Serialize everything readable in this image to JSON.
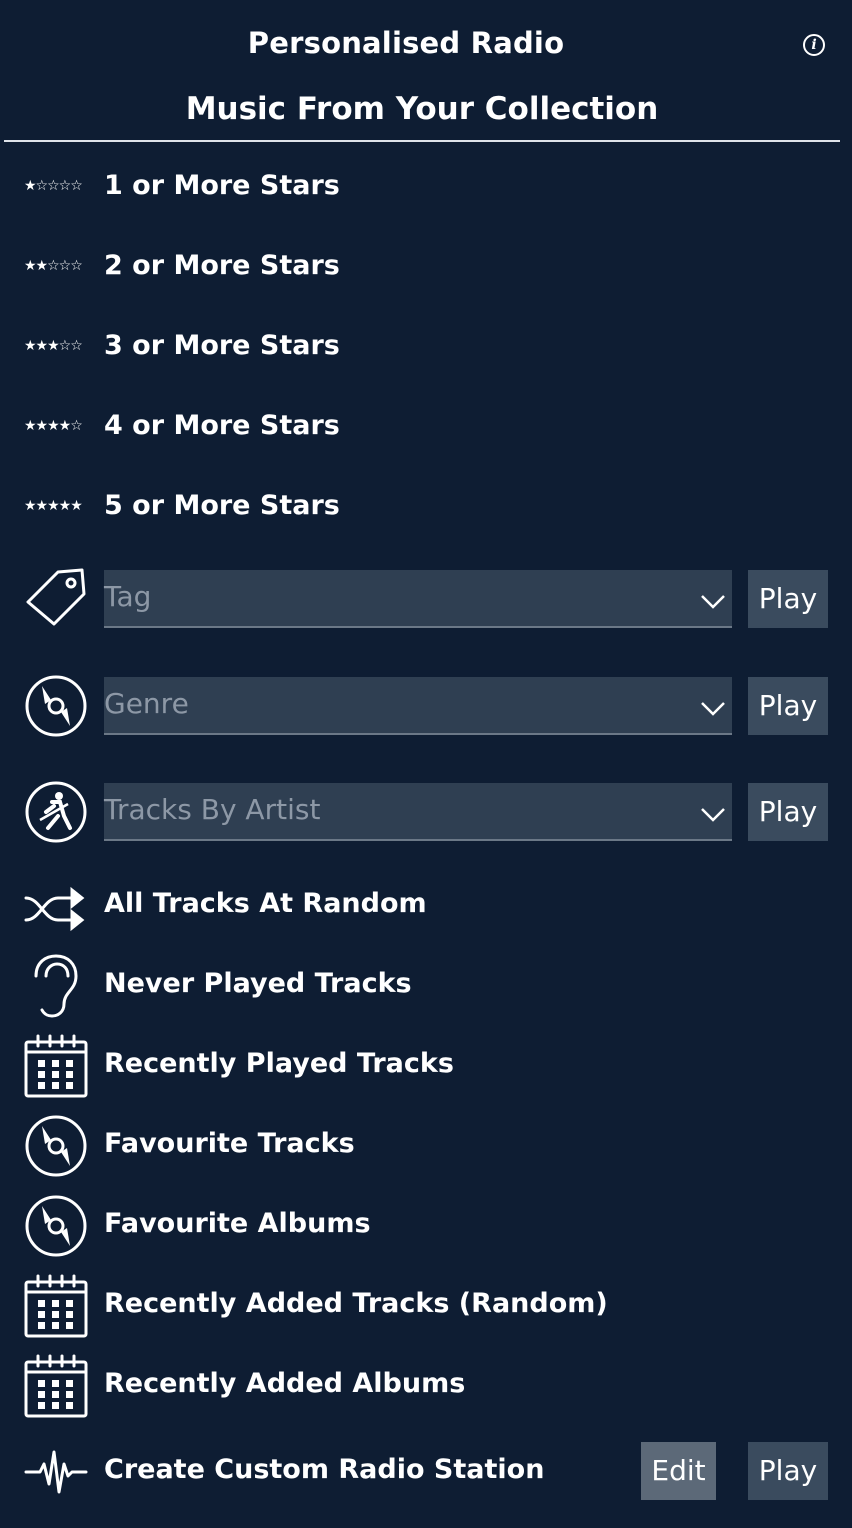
{
  "header": {
    "title": "Personalised Radio",
    "subtitle": "Music From Your Collection"
  },
  "star_items": [
    {
      "stars": "★☆☆☆☆",
      "label": "1 or More Stars"
    },
    {
      "stars": "★★☆☆☆",
      "label": "2 or More Stars"
    },
    {
      "stars": "★★★☆☆",
      "label": "3 or More Stars"
    },
    {
      "stars": "★★★★☆",
      "label": "4 or More Stars"
    },
    {
      "stars": "★★★★★",
      "label": "5 or More Stars"
    }
  ],
  "selectors": [
    {
      "icon": "tag-icon",
      "placeholder": "Tag",
      "play_label": "Play"
    },
    {
      "icon": "disc-icon",
      "placeholder": "Genre",
      "play_label": "Play"
    },
    {
      "icon": "guitarist-icon",
      "placeholder": "Tracks By Artist",
      "play_label": "Play"
    }
  ],
  "list_items": [
    {
      "icon": "shuffle-icon",
      "label": "All Tracks At Random"
    },
    {
      "icon": "ear-icon",
      "label": "Never Played Tracks"
    },
    {
      "icon": "calendar-icon",
      "label": "Recently Played Tracks"
    },
    {
      "icon": "disc-icon",
      "label": "Favourite Tracks"
    },
    {
      "icon": "disc-icon",
      "label": "Favourite Albums"
    },
    {
      "icon": "calendar-icon",
      "label": "Recently Added Tracks (Random)"
    },
    {
      "icon": "calendar-icon",
      "label": "Recently Added Albums"
    }
  ],
  "custom_station": {
    "icon": "waveform-icon",
    "label": "Create Custom Radio Station",
    "edit_label": "Edit",
    "play_label": "Play"
  },
  "colors": {
    "background": "#0e1d33",
    "select_bg": "#2f3f52",
    "button_bg": "#3a4b5e",
    "edit_bg": "#5c6978",
    "text": "#ffffff",
    "placeholder": "#8d98a6"
  }
}
